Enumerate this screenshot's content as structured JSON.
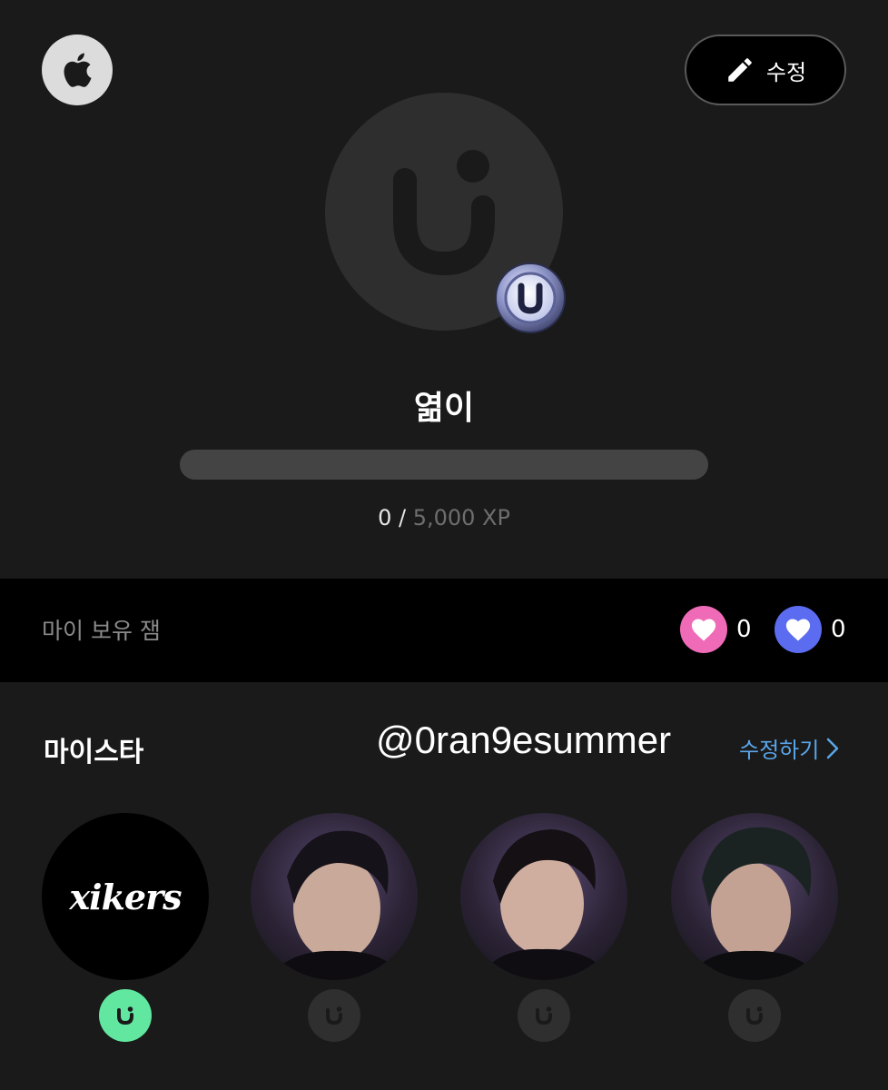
{
  "header": {
    "edit_label": "수정"
  },
  "profile": {
    "nickname": "엶이",
    "xp_current": "0 /",
    "xp_max": "5,000 XP",
    "xp_progress": 0
  },
  "gems": {
    "label": "마이 보유 잼",
    "pink_count": "0",
    "blue_count": "0",
    "pink_color": "#f06bb7",
    "blue_color": "#5b6cf0"
  },
  "mystar": {
    "title": "마이스타",
    "handle": "@0ran9esummer",
    "edit_link_label": "수정하기",
    "logo_text": "xikers",
    "active_color": "#61e7a0",
    "inactive_color": "#2f2f2f"
  },
  "icons": {
    "apple": "apple-icon",
    "pencil": "pencil-icon",
    "heart": "heart-icon",
    "chevron": "chevron-right-icon",
    "u_logo": "u-logo-icon"
  }
}
